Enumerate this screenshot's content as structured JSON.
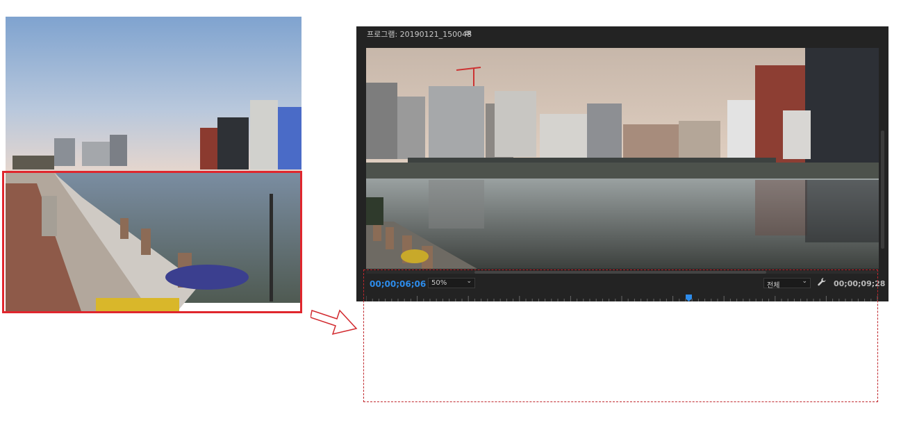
{
  "left_image": {
    "description_icon": "river-walkway-photo-icon"
  },
  "arrow": {
    "icon": "arrow-right-outline-icon"
  },
  "program_monitor": {
    "title": "프로그램: 20190121_150048",
    "menu_icon": "≡",
    "current_timecode": "00;00;06;06",
    "zoom_level": "50%",
    "resolution": "전체",
    "settings_icon": "wrench-icon",
    "duration_timecode": "00;00;09;28",
    "playhead_position": 0.63
  },
  "colors": {
    "panel_bg": "#232323",
    "timecode_accent": "#2d8ceb",
    "highlight_red": "#e0262d",
    "dashed_red": "#c0272d"
  }
}
